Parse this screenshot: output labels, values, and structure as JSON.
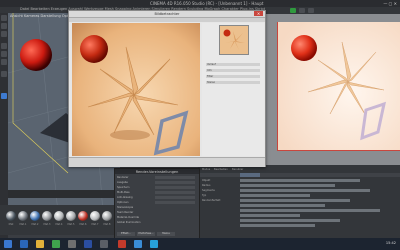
{
  "app": {
    "title": "CINEMA 4D R16.050 Studio (RC) - [Unbenannt 1] - Haupt",
    "menu": "Datei  Bearbeiten  Erzeugen  Auswahl  Werkzeuge  Mesh  Snapping  Animieren  Simulieren  Rendern  Sculpting  MoGraph  Charakter  Plug-ins  Skript  Fenster  Hilfe"
  },
  "picture_viewer": {
    "title": "Bildbetrachter",
    "close_label": "×",
    "side_rows": [
      "Verlauf",
      "Info",
      "Filter",
      "Stereo"
    ]
  },
  "render_settings": {
    "title": "Render-Voreinstellungen",
    "items": [
      "Renderer",
      "Ausgabe",
      "Speichern",
      "Multi-Pass",
      "Anti-Aliasing",
      "Optionen",
      "Stereoskopie",
      "Team Render",
      "Material-Override",
      "Global Illumination"
    ],
    "buttons": [
      "Effekt...",
      "Multi-Pass...",
      "Meine"
    ]
  },
  "attributes": {
    "labels": [
      "Modus",
      "Bearbeiten",
      "Benutzer",
      "Basis",
      "Koord.",
      "Objekt",
      "Phong",
      "Textur",
      "Radius",
      "Segmente",
      "Typ",
      "Render-Perfekt"
    ]
  },
  "materials": {
    "labels": [
      "Mat",
      "Mat.1",
      "Mat.2",
      "Mat.3",
      "Mat.4",
      "Mat.5",
      "Mat.6",
      "Mat.7",
      "Mat.8"
    ],
    "colors": [
      "#4a5560",
      "#6a7078",
      "#3b6fb0",
      "#8f9398",
      "#b0b3b6",
      "#a4a7aa",
      "#c03025",
      "#b5b8bb",
      "#9a9da0"
    ]
  },
  "taskbar": {
    "clock": "15:42"
  },
  "colors": {
    "accent_red": "#c9463d",
    "backdrop_warm": "#f2c89a"
  }
}
